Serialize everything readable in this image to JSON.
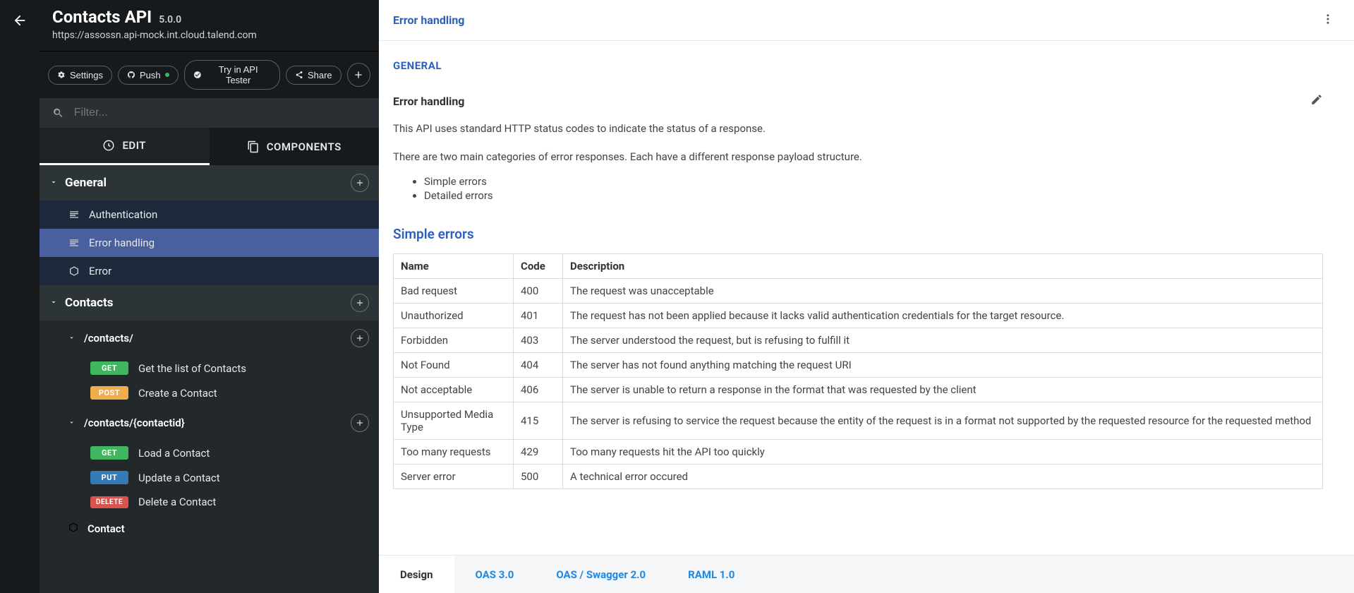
{
  "header": {
    "title": "Contacts API",
    "version": "5.0.0",
    "url": "https://assossn.api-mock.int.cloud.talend.com"
  },
  "toolbar": {
    "settings": "Settings",
    "push": "Push",
    "try": "Try in API Tester",
    "share": "Share"
  },
  "search": {
    "placeholder": "Filter..."
  },
  "tabs": {
    "edit": "EDIT",
    "components": "COMPONENTS"
  },
  "tree": {
    "general": {
      "label": "General",
      "items": [
        {
          "icon": "text",
          "label": "Authentication"
        },
        {
          "icon": "text",
          "label": "Error handling"
        },
        {
          "icon": "cube",
          "label": "Error"
        }
      ]
    },
    "contacts": {
      "label": "Contacts",
      "paths": [
        {
          "path": "/contacts/",
          "ops": [
            {
              "method": "GET",
              "label": "Get the list of Contacts"
            },
            {
              "method": "POST",
              "label": "Create a Contact"
            }
          ]
        },
        {
          "path": "/contacts/{contactid}",
          "ops": [
            {
              "method": "GET",
              "label": "Load a Contact"
            },
            {
              "method": "PUT",
              "label": "Update a Contact"
            },
            {
              "method": "DELETE",
              "label": "Delete a Contact"
            }
          ]
        }
      ],
      "types": [
        {
          "label": "Contact"
        }
      ]
    }
  },
  "main": {
    "breadcrumb": "Error handling",
    "section_label": "GENERAL",
    "title": "Error handling",
    "p1": "This API uses standard HTTP status codes to indicate the status of a response.",
    "p2": "There are two main categories of error responses. Each have a different response payload structure.",
    "bullets": [
      "Simple errors",
      "Detailed errors"
    ],
    "subheading": "Simple errors",
    "table": {
      "headers": [
        "Name",
        "Code",
        "Description"
      ],
      "rows": [
        [
          "Bad request",
          "400",
          "The request was unacceptable"
        ],
        [
          "Unauthorized",
          "401",
          "The request has not been applied because it lacks valid authentication credentials for the target resource."
        ],
        [
          "Forbidden",
          "403",
          "The server understood the request, but is refusing to fulfill it"
        ],
        [
          "Not Found",
          "404",
          "The server has not found anything matching the request URI"
        ],
        [
          "Not acceptable",
          "406",
          "The server is unable to return a response in the format that was requested by the client"
        ],
        [
          "Unsupported Media Type",
          "415",
          "The server is refusing to service the request because the entity of the request is in a format not supported by the requested resource for the requested method"
        ],
        [
          "Too many requests",
          "429",
          "Too many requests hit the API too quickly"
        ],
        [
          "Server error",
          "500",
          "A technical error occured"
        ]
      ]
    }
  },
  "bottom_tabs": {
    "design": "Design",
    "oas3": "OAS 3.0",
    "swagger2": "OAS / Swagger 2.0",
    "raml": "RAML 1.0"
  }
}
